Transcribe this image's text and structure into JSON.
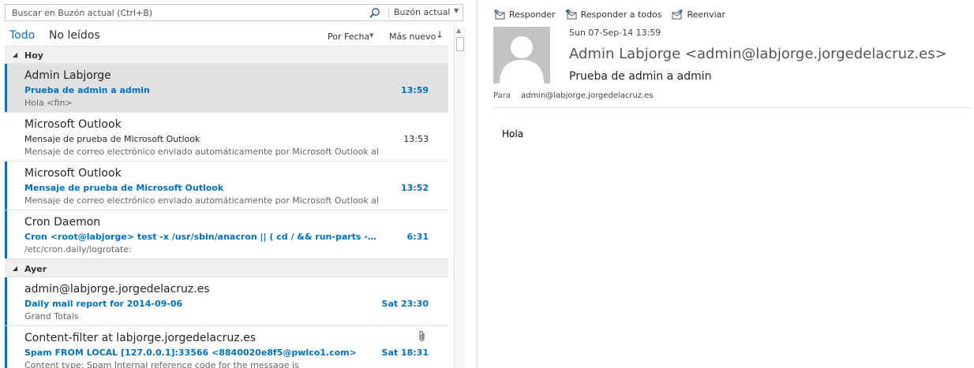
{
  "search": {
    "placeholder": "Buscar en Buzón actual (Ctrl+B)",
    "scope": "Buzón actual"
  },
  "filters": {
    "all": "Todo",
    "unread": "No leídos",
    "sort_by": "Por Fecha",
    "sort_order": "Más nuevo",
    "sort_order_arrow": "↓"
  },
  "groups": [
    {
      "label": "Hoy",
      "messages": [
        {
          "sender": "Admin Labjorge",
          "subject": "Prueba de admin a admin",
          "preview": "Hola <fin>",
          "time": "13:59",
          "unread": true,
          "selected": true,
          "attachment": false
        },
        {
          "sender": "Microsoft Outlook",
          "subject": "Mensaje de prueba de Microsoft Outlook",
          "preview": "Mensaje de correo electrónico enviado automáticamente por Microsoft Outlook al",
          "time": "13:53",
          "unread": false,
          "selected": false,
          "attachment": false
        },
        {
          "sender": "Microsoft Outlook",
          "subject": "Mensaje de prueba de Microsoft Outlook",
          "preview": "Mensaje de correo electrónico enviado automáticamente por Microsoft Outlook al",
          "time": "13:52",
          "unread": true,
          "selected": false,
          "attachment": false
        },
        {
          "sender": "Cron Daemon",
          "subject": "Cron <root@labjorge> test -x /usr/sbin/anacron || ( cd / && run-parts --report /et...",
          "preview": "/etc/cron.daily/logrotate:",
          "time": "6:31",
          "unread": true,
          "selected": false,
          "attachment": false
        }
      ]
    },
    {
      "label": "Ayer",
      "messages": [
        {
          "sender": "admin@labjorge.jorgedelacruz.es",
          "subject": "Daily mail report for 2014-09-06",
          "preview": "Grand Totals",
          "time": "Sat 23:30",
          "unread": true,
          "selected": false,
          "attachment": false
        },
        {
          "sender": "Content-filter at labjorge.jorgedelacruz.es",
          "subject": "Spam FROM LOCAL [127.0.0.1]:33566 <8840020e8f5@pwlco1.com>",
          "preview": "Content type: Spam  Internal reference code for the message is",
          "time": "Sat 18:31",
          "unread": true,
          "selected": false,
          "attachment": true
        }
      ]
    }
  ],
  "reading": {
    "actions": {
      "reply": "Responder",
      "reply_all": "Responder a todos",
      "forward": "Reenviar"
    },
    "sent": "Sun 07-Sep-14 13:59",
    "from": "Admin Labjorge <admin@labjorge.jorgedelacruz.es>",
    "subject": "Prueba de admin a admin",
    "to_label": "Para",
    "to": "admin@labjorge.jorgedelacruz.es",
    "body": "Hola"
  },
  "colors": {
    "accent": "#0072c6",
    "selected_row": "#e1e1e1",
    "group_header": "#f0f0f0"
  }
}
